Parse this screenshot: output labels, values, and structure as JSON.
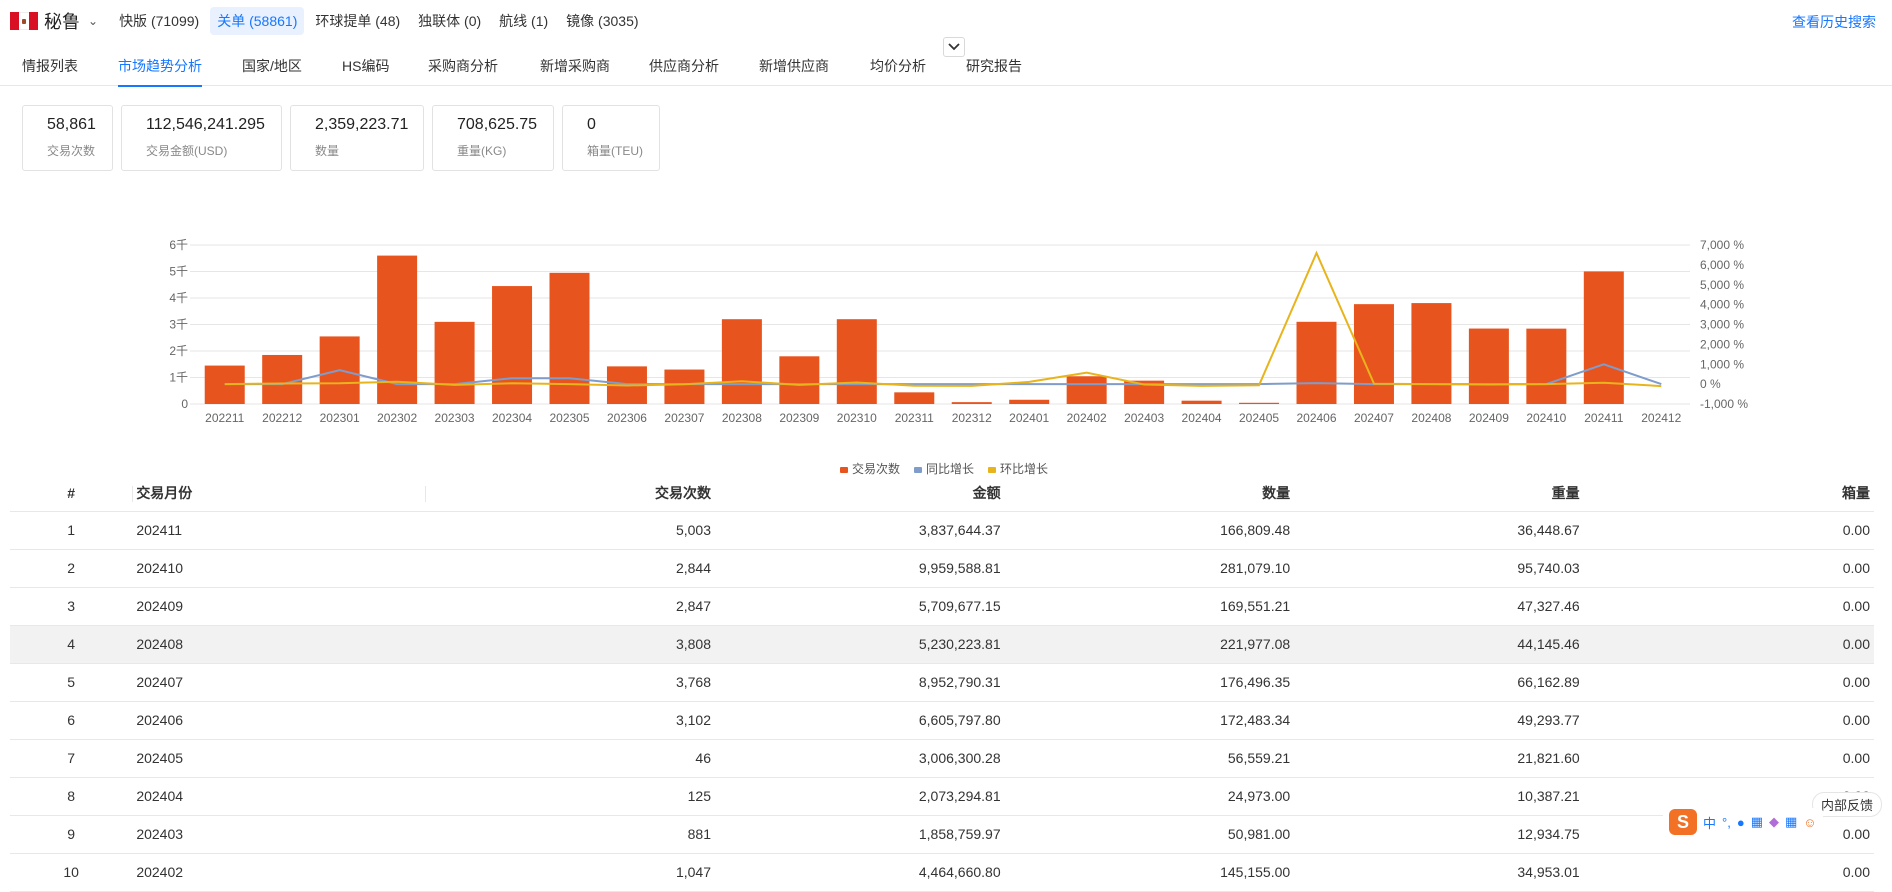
{
  "topbar": {
    "country": "秘鲁",
    "sources": [
      {
        "label": "快版 (71099)",
        "active": false
      },
      {
        "label": "关单 (58861)",
        "active": true
      },
      {
        "label": "环球提单 (48)",
        "active": false
      },
      {
        "label": "独联体 (0)",
        "active": false
      },
      {
        "label": "航线 (1)",
        "active": false
      },
      {
        "label": "镜像 (3035)",
        "active": false
      }
    ],
    "history_link": "查看历史搜索"
  },
  "subnav": {
    "items": [
      {
        "label": "情报列表",
        "active": false
      },
      {
        "label": "市场趋势分析",
        "active": true
      },
      {
        "label": "国家/地区",
        "active": false
      },
      {
        "label": "HS编码",
        "active": false
      },
      {
        "label": "采购商分析",
        "active": false
      },
      {
        "label": "新增采购商",
        "active": false
      },
      {
        "label": "供应商分析",
        "active": false
      },
      {
        "label": "新增供应商",
        "active": false
      },
      {
        "label": "均价分析",
        "active": false
      },
      {
        "label": "研究报告",
        "active": false
      }
    ]
  },
  "stats": [
    {
      "value": "58,861",
      "label": "交易次数"
    },
    {
      "value": "112,546,241.295",
      "label": "交易金额(USD)"
    },
    {
      "value": "2,359,223.71",
      "label": "数量"
    },
    {
      "value": "708,625.75",
      "label": "重量(KG)"
    },
    {
      "value": "0",
      "label": "箱量(TEU)"
    }
  ],
  "chart_data": {
    "type": "bar",
    "categories": [
      "202211",
      "202212",
      "202301",
      "202302",
      "202303",
      "202304",
      "202305",
      "202306",
      "202307",
      "202308",
      "202309",
      "202310",
      "202311",
      "202312",
      "202401",
      "202402",
      "202403",
      "202404",
      "202405",
      "202406",
      "202407",
      "202408",
      "202409",
      "202410",
      "202411",
      "202412"
    ],
    "series": [
      {
        "name": "交易次数",
        "type": "bar",
        "axis": "left",
        "color": "#e8541e",
        "values": [
          1450,
          1850,
          2550,
          5600,
          3100,
          4450,
          4950,
          1420,
          1300,
          3200,
          1800,
          3200,
          440,
          70,
          160,
          1047,
          881,
          125,
          46,
          3102,
          3768,
          3808,
          2847,
          2844,
          5003,
          0
        ]
      },
      {
        "name": "同比增长",
        "type": "line",
        "axis": "right",
        "color": "#7f9ccb",
        "values": [
          0,
          0,
          700,
          0,
          0,
          300,
          300,
          0,
          0,
          0,
          0,
          0,
          0,
          0,
          0,
          0,
          0,
          0,
          0,
          50,
          0,
          0,
          0,
          0,
          1000,
          0
        ]
      },
      {
        "name": "环比增长",
        "type": "line",
        "axis": "right",
        "color": "#e8b41c",
        "values": [
          0,
          30,
          40,
          120,
          -40,
          40,
          0,
          -70,
          -10,
          140,
          -40,
          80,
          -80,
          -90,
          110,
          580,
          -20,
          -90,
          -60,
          6600,
          20,
          0,
          -20,
          0,
          70,
          -100
        ]
      }
    ],
    "y_left": {
      "ticks": [
        "0",
        "1千",
        "2千",
        "3千",
        "4千",
        "5千",
        "6千"
      ],
      "range": [
        0,
        6000
      ]
    },
    "y_right": {
      "ticks": [
        "-1,000 %",
        "0 %",
        "1,000 %",
        "2,000 %",
        "3,000 %",
        "4,000 %",
        "5,000 %",
        "6,000 %",
        "7,000 %"
      ],
      "range": [
        -1000,
        7000
      ]
    },
    "legend_placement": "bottom-center",
    "grid": true
  },
  "table": {
    "headers": [
      "#",
      "交易月份",
      "交易次数",
      "金额",
      "数量",
      "重量",
      "箱量"
    ],
    "rows": [
      [
        "1",
        "202411",
        "5,003",
        "3,837,644.37",
        "166,809.48",
        "36,448.67",
        "0.00"
      ],
      [
        "2",
        "202410",
        "2,844",
        "9,959,588.81",
        "281,079.10",
        "95,740.03",
        "0.00"
      ],
      [
        "3",
        "202409",
        "2,847",
        "5,709,677.15",
        "169,551.21",
        "47,327.46",
        "0.00"
      ],
      [
        "4",
        "202408",
        "3,808",
        "5,230,223.81",
        "221,977.08",
        "44,145.46",
        "0.00"
      ],
      [
        "5",
        "202407",
        "3,768",
        "8,952,790.31",
        "176,496.35",
        "66,162.89",
        "0.00"
      ],
      [
        "6",
        "202406",
        "3,102",
        "6,605,797.80",
        "172,483.34",
        "49,293.77",
        "0.00"
      ],
      [
        "7",
        "202405",
        "46",
        "3,006,300.28",
        "56,559.21",
        "21,821.60",
        "0.00"
      ],
      [
        "8",
        "202404",
        "125",
        "2,073,294.81",
        "24,973.00",
        "10,387.21",
        "0.00"
      ],
      [
        "9",
        "202403",
        "881",
        "1,858,759.97",
        "50,981.00",
        "12,934.75",
        "0.00"
      ],
      [
        "10",
        "202402",
        "1,047",
        "4,464,660.80",
        "145,155.00",
        "34,953.01",
        "0.00"
      ]
    ],
    "highlighted_row": 3
  },
  "feedback": "内部反馈",
  "ime": {
    "label": "中"
  }
}
